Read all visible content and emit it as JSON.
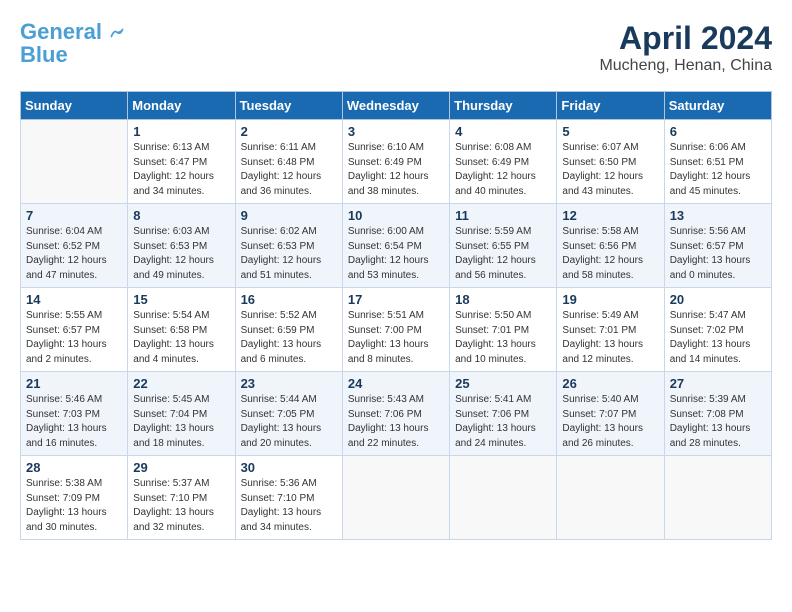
{
  "logo": {
    "line1": "General",
    "line2": "Blue"
  },
  "title": "April 2024",
  "location": "Mucheng, Henan, China",
  "days_header": [
    "Sunday",
    "Monday",
    "Tuesday",
    "Wednesday",
    "Thursday",
    "Friday",
    "Saturday"
  ],
  "weeks": [
    [
      {
        "day": "",
        "info": ""
      },
      {
        "day": "1",
        "info": "Sunrise: 6:13 AM\nSunset: 6:47 PM\nDaylight: 12 hours\nand 34 minutes."
      },
      {
        "day": "2",
        "info": "Sunrise: 6:11 AM\nSunset: 6:48 PM\nDaylight: 12 hours\nand 36 minutes."
      },
      {
        "day": "3",
        "info": "Sunrise: 6:10 AM\nSunset: 6:49 PM\nDaylight: 12 hours\nand 38 minutes."
      },
      {
        "day": "4",
        "info": "Sunrise: 6:08 AM\nSunset: 6:49 PM\nDaylight: 12 hours\nand 40 minutes."
      },
      {
        "day": "5",
        "info": "Sunrise: 6:07 AM\nSunset: 6:50 PM\nDaylight: 12 hours\nand 43 minutes."
      },
      {
        "day": "6",
        "info": "Sunrise: 6:06 AM\nSunset: 6:51 PM\nDaylight: 12 hours\nand 45 minutes."
      }
    ],
    [
      {
        "day": "7",
        "info": "Sunrise: 6:04 AM\nSunset: 6:52 PM\nDaylight: 12 hours\nand 47 minutes."
      },
      {
        "day": "8",
        "info": "Sunrise: 6:03 AM\nSunset: 6:53 PM\nDaylight: 12 hours\nand 49 minutes."
      },
      {
        "day": "9",
        "info": "Sunrise: 6:02 AM\nSunset: 6:53 PM\nDaylight: 12 hours\nand 51 minutes."
      },
      {
        "day": "10",
        "info": "Sunrise: 6:00 AM\nSunset: 6:54 PM\nDaylight: 12 hours\nand 53 minutes."
      },
      {
        "day": "11",
        "info": "Sunrise: 5:59 AM\nSunset: 6:55 PM\nDaylight: 12 hours\nand 56 minutes."
      },
      {
        "day": "12",
        "info": "Sunrise: 5:58 AM\nSunset: 6:56 PM\nDaylight: 12 hours\nand 58 minutes."
      },
      {
        "day": "13",
        "info": "Sunrise: 5:56 AM\nSunset: 6:57 PM\nDaylight: 13 hours\nand 0 minutes."
      }
    ],
    [
      {
        "day": "14",
        "info": "Sunrise: 5:55 AM\nSunset: 6:57 PM\nDaylight: 13 hours\nand 2 minutes."
      },
      {
        "day": "15",
        "info": "Sunrise: 5:54 AM\nSunset: 6:58 PM\nDaylight: 13 hours\nand 4 minutes."
      },
      {
        "day": "16",
        "info": "Sunrise: 5:52 AM\nSunset: 6:59 PM\nDaylight: 13 hours\nand 6 minutes."
      },
      {
        "day": "17",
        "info": "Sunrise: 5:51 AM\nSunset: 7:00 PM\nDaylight: 13 hours\nand 8 minutes."
      },
      {
        "day": "18",
        "info": "Sunrise: 5:50 AM\nSunset: 7:01 PM\nDaylight: 13 hours\nand 10 minutes."
      },
      {
        "day": "19",
        "info": "Sunrise: 5:49 AM\nSunset: 7:01 PM\nDaylight: 13 hours\nand 12 minutes."
      },
      {
        "day": "20",
        "info": "Sunrise: 5:47 AM\nSunset: 7:02 PM\nDaylight: 13 hours\nand 14 minutes."
      }
    ],
    [
      {
        "day": "21",
        "info": "Sunrise: 5:46 AM\nSunset: 7:03 PM\nDaylight: 13 hours\nand 16 minutes."
      },
      {
        "day": "22",
        "info": "Sunrise: 5:45 AM\nSunset: 7:04 PM\nDaylight: 13 hours\nand 18 minutes."
      },
      {
        "day": "23",
        "info": "Sunrise: 5:44 AM\nSunset: 7:05 PM\nDaylight: 13 hours\nand 20 minutes."
      },
      {
        "day": "24",
        "info": "Sunrise: 5:43 AM\nSunset: 7:06 PM\nDaylight: 13 hours\nand 22 minutes."
      },
      {
        "day": "25",
        "info": "Sunrise: 5:41 AM\nSunset: 7:06 PM\nDaylight: 13 hours\nand 24 minutes."
      },
      {
        "day": "26",
        "info": "Sunrise: 5:40 AM\nSunset: 7:07 PM\nDaylight: 13 hours\nand 26 minutes."
      },
      {
        "day": "27",
        "info": "Sunrise: 5:39 AM\nSunset: 7:08 PM\nDaylight: 13 hours\nand 28 minutes."
      }
    ],
    [
      {
        "day": "28",
        "info": "Sunrise: 5:38 AM\nSunset: 7:09 PM\nDaylight: 13 hours\nand 30 minutes."
      },
      {
        "day": "29",
        "info": "Sunrise: 5:37 AM\nSunset: 7:10 PM\nDaylight: 13 hours\nand 32 minutes."
      },
      {
        "day": "30",
        "info": "Sunrise: 5:36 AM\nSunset: 7:10 PM\nDaylight: 13 hours\nand 34 minutes."
      },
      {
        "day": "",
        "info": ""
      },
      {
        "day": "",
        "info": ""
      },
      {
        "day": "",
        "info": ""
      },
      {
        "day": "",
        "info": ""
      }
    ]
  ]
}
